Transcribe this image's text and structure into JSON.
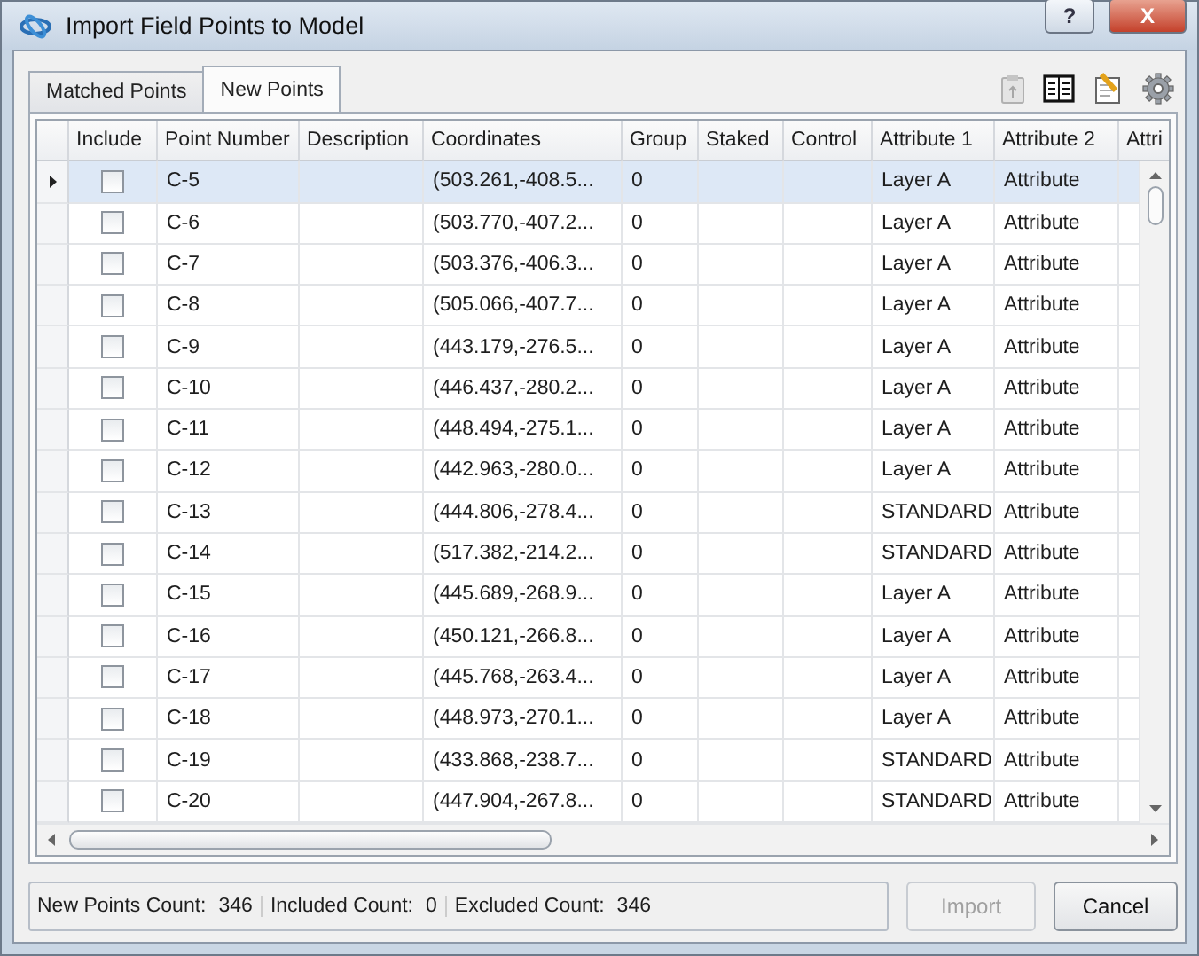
{
  "window": {
    "title": "Import Field Points to Model",
    "help_button": "?",
    "close_button": "X"
  },
  "tabs": [
    {
      "label": "Matched Points",
      "selected": false
    },
    {
      "label": "New Points",
      "selected": true
    }
  ],
  "toolbar": [
    {
      "kind": "clipboard",
      "disabled": true
    },
    {
      "kind": "columns",
      "disabled": false
    },
    {
      "kind": "note",
      "disabled": false
    },
    {
      "kind": "gear",
      "disabled": false
    }
  ],
  "table": {
    "columns": [
      "Include",
      "Point Number",
      "Description",
      "Coordinates",
      "Group",
      "Staked",
      "Control",
      "Attribute 1",
      "Attribute 2",
      "Attri"
    ],
    "rows": [
      {
        "selected": true,
        "include": false,
        "point": "C-5",
        "coordinates": "(503.261,-408.5...",
        "group": "0",
        "attribute_1": "Layer A",
        "attribute_2": "Attribute"
      },
      {
        "selected": false,
        "include": false,
        "point": "C-6",
        "coordinates": "(503.770,-407.2...",
        "group": "0",
        "attribute_1": "Layer A",
        "attribute_2": "Attribute"
      },
      {
        "selected": false,
        "include": false,
        "point": "C-7",
        "coordinates": "(503.376,-406.3...",
        "group": "0",
        "attribute_1": "Layer A",
        "attribute_2": "Attribute"
      },
      {
        "selected": false,
        "include": false,
        "point": "C-8",
        "coordinates": "(505.066,-407.7...",
        "group": "0",
        "attribute_1": "Layer A",
        "attribute_2": "Attribute"
      },
      {
        "selected": false,
        "include": false,
        "point": "C-9",
        "coordinates": "(443.179,-276.5...",
        "group": "0",
        "attribute_1": "Layer A",
        "attribute_2": "Attribute"
      },
      {
        "selected": false,
        "include": false,
        "point": "C-10",
        "coordinates": "(446.437,-280.2...",
        "group": "0",
        "attribute_1": "Layer A",
        "attribute_2": "Attribute"
      },
      {
        "selected": false,
        "include": false,
        "point": "C-11",
        "coordinates": "(448.494,-275.1...",
        "group": "0",
        "attribute_1": "Layer A",
        "attribute_2": "Attribute"
      },
      {
        "selected": false,
        "include": false,
        "point": "C-12",
        "coordinates": "(442.963,-280.0...",
        "group": "0",
        "attribute_1": "Layer A",
        "attribute_2": "Attribute"
      },
      {
        "selected": false,
        "include": false,
        "point": "C-13",
        "coordinates": "(444.806,-278.4...",
        "group": "0",
        "attribute_1": "STANDARD",
        "attribute_2": "Attribute"
      },
      {
        "selected": false,
        "include": false,
        "point": "C-14",
        "coordinates": "(517.382,-214.2...",
        "group": "0",
        "attribute_1": "STANDARD",
        "attribute_2": "Attribute"
      },
      {
        "selected": false,
        "include": false,
        "point": "C-15",
        "coordinates": "(445.689,-268.9...",
        "group": "0",
        "attribute_1": "Layer A",
        "attribute_2": "Attribute"
      },
      {
        "selected": false,
        "include": false,
        "point": "C-16",
        "coordinates": "(450.121,-266.8...",
        "group": "0",
        "attribute_1": "Layer A",
        "attribute_2": "Attribute"
      },
      {
        "selected": false,
        "include": false,
        "point": "C-17",
        "coordinates": "(445.768,-263.4...",
        "group": "0",
        "attribute_1": "Layer A",
        "attribute_2": "Attribute"
      },
      {
        "selected": false,
        "include": false,
        "point": "C-18",
        "coordinates": "(448.973,-270.1...",
        "group": "0",
        "attribute_1": "Layer A",
        "attribute_2": "Attribute"
      },
      {
        "selected": false,
        "include": false,
        "point": "C-19",
        "coordinates": "(433.868,-238.7...",
        "group": "0",
        "attribute_1": "STANDARD",
        "attribute_2": "Attribute"
      },
      {
        "selected": false,
        "include": false,
        "point": "C-20",
        "coordinates": "(447.904,-267.8...",
        "group": "0",
        "attribute_1": "STANDARD",
        "attribute_2": "Attribute"
      }
    ]
  },
  "status": [
    {
      "label": "New Points Count:",
      "value": "346"
    },
    {
      "label": "Included Count:",
      "value": "0"
    },
    {
      "label": "Excluded Count:",
      "value": "346"
    }
  ],
  "buttons": [
    {
      "label": "Import",
      "disabled": true
    },
    {
      "label": "Cancel",
      "disabled": false
    }
  ]
}
